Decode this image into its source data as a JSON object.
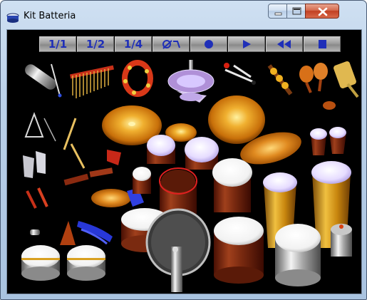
{
  "window": {
    "title": "Kit Batteria"
  },
  "toolbar": {
    "buttons": [
      {
        "label": "1/1"
      },
      {
        "label": "1/2"
      },
      {
        "label": "1/4"
      },
      {
        "label": "",
        "icon": "metronome-icon"
      },
      {
        "label": "",
        "icon": "record-icon"
      },
      {
        "label": "",
        "icon": "play-icon"
      },
      {
        "label": "",
        "icon": "rewind-icon"
      },
      {
        "label": "",
        "icon": "stop-icon"
      }
    ]
  },
  "colors": {
    "background": "#000000",
    "toolbar_text": "#1f2fb8",
    "cymbal": "#e0a020",
    "drum_shell": "#8a2a14",
    "drum_head": "#ffffff",
    "conga": "#d4961e"
  }
}
